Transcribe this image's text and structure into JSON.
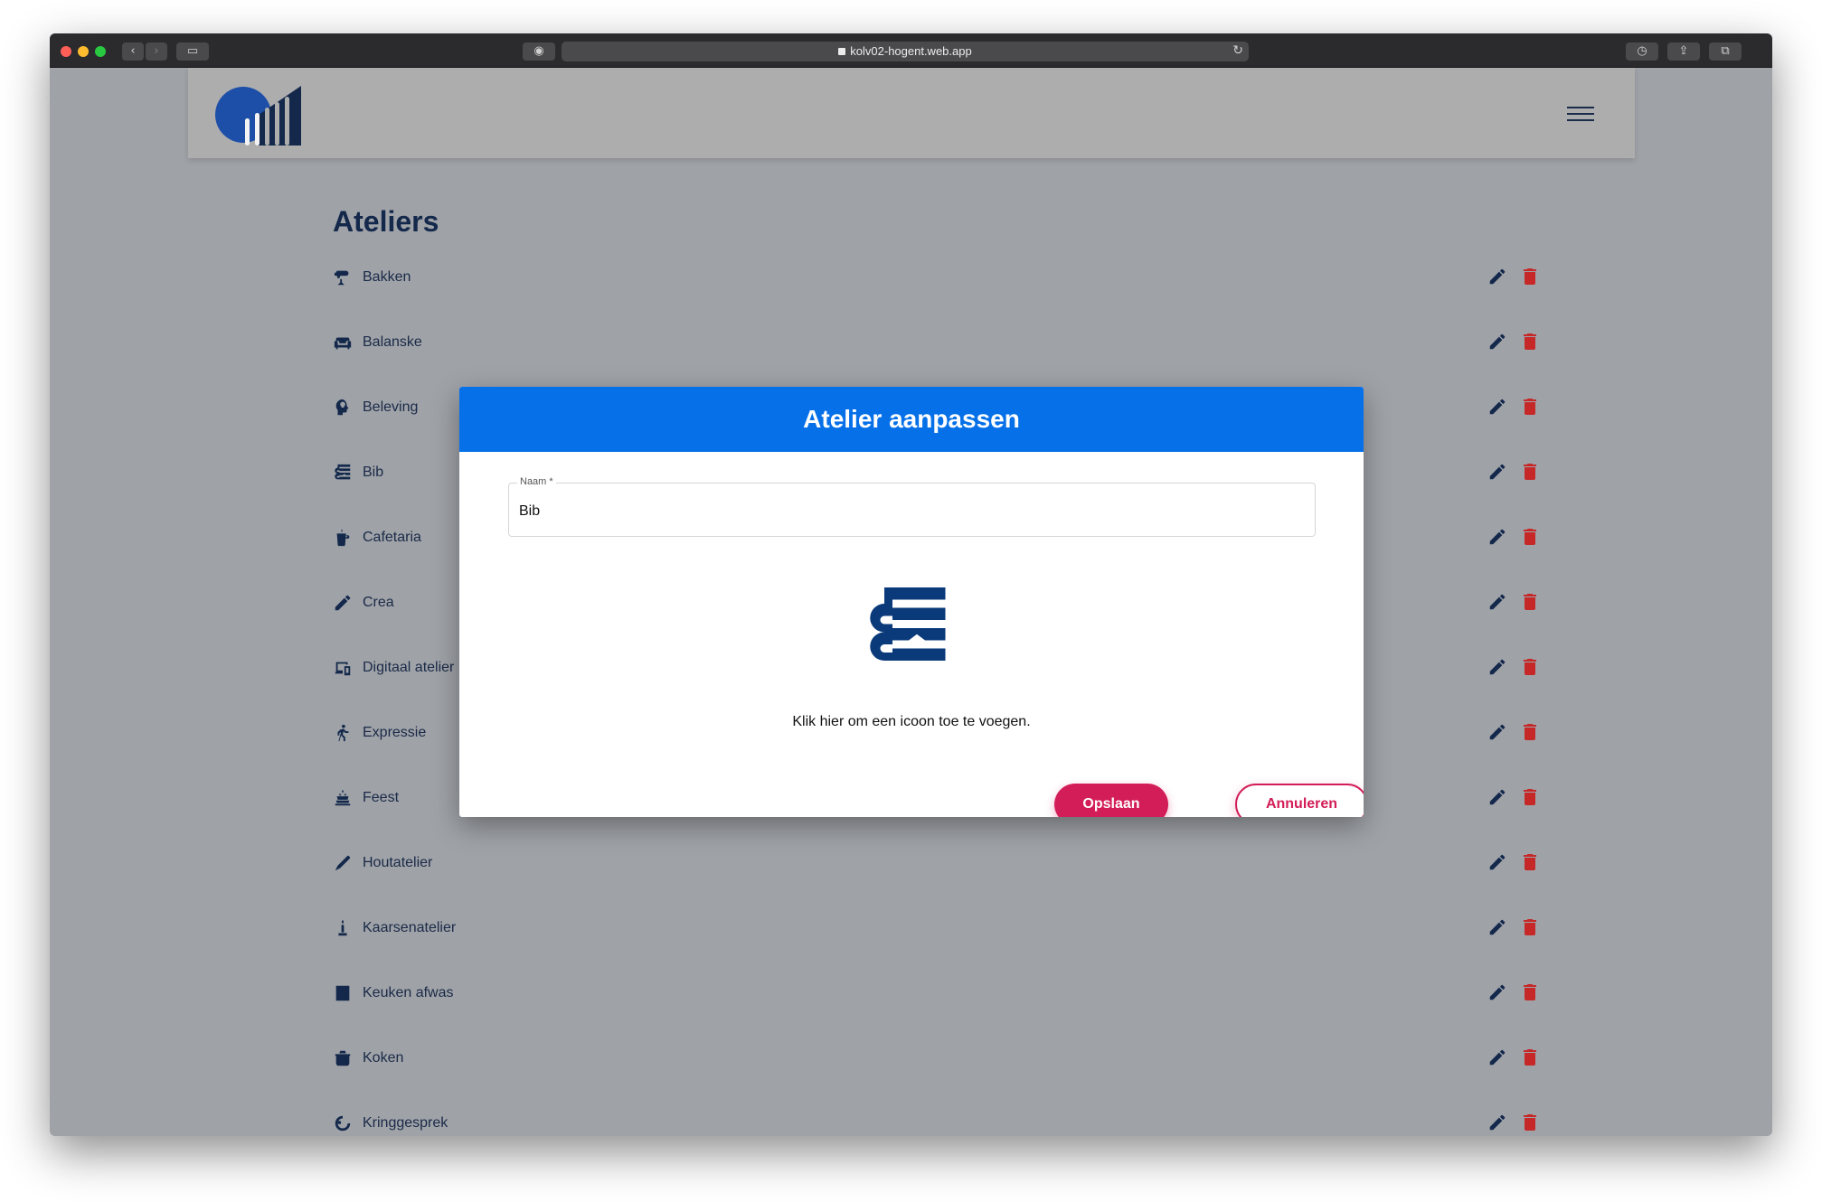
{
  "browser": {
    "url": "kolv02-hogent.web.app"
  },
  "page": {
    "title": "Ateliers"
  },
  "ateliers": [
    {
      "label": "Bakken",
      "icon": "mixer-icon"
    },
    {
      "label": "Balanske",
      "icon": "sofa-icon"
    },
    {
      "label": "Beleving",
      "icon": "head-lightbulb-icon"
    },
    {
      "label": "Bib",
      "icon": "books-icon"
    },
    {
      "label": "Cafetaria",
      "icon": "coffee-cup-icon"
    },
    {
      "label": "Crea",
      "icon": "pencil-icon"
    },
    {
      "label": "Digitaal atelier",
      "icon": "devices-icon"
    },
    {
      "label": "Expressie",
      "icon": "dancer-icon"
    },
    {
      "label": "Feest",
      "icon": "cake-icon"
    },
    {
      "label": "Houtatelier",
      "icon": "saw-icon"
    },
    {
      "label": "Kaarsenatelier",
      "icon": "candle-icon"
    },
    {
      "label": "Keuken afwas",
      "icon": "dishwasher-icon"
    },
    {
      "label": "Koken",
      "icon": "pot-icon"
    },
    {
      "label": "Kringgesprek",
      "icon": "people-circle-icon"
    }
  ],
  "modal": {
    "title": "Atelier aanpassen",
    "name_label": "Naam *",
    "name_value": "Bib",
    "icon": "books-icon",
    "hint": "Klik hier om een icoon toe te voegen.",
    "save_label": "Opslaan",
    "cancel_label": "Annuleren"
  },
  "colors": {
    "primary_blue": "#0670e8",
    "navy": "#13284b",
    "accent": "#d31d58",
    "delete_red": "#c62828",
    "overlay_bg": "#9fa2a7"
  }
}
